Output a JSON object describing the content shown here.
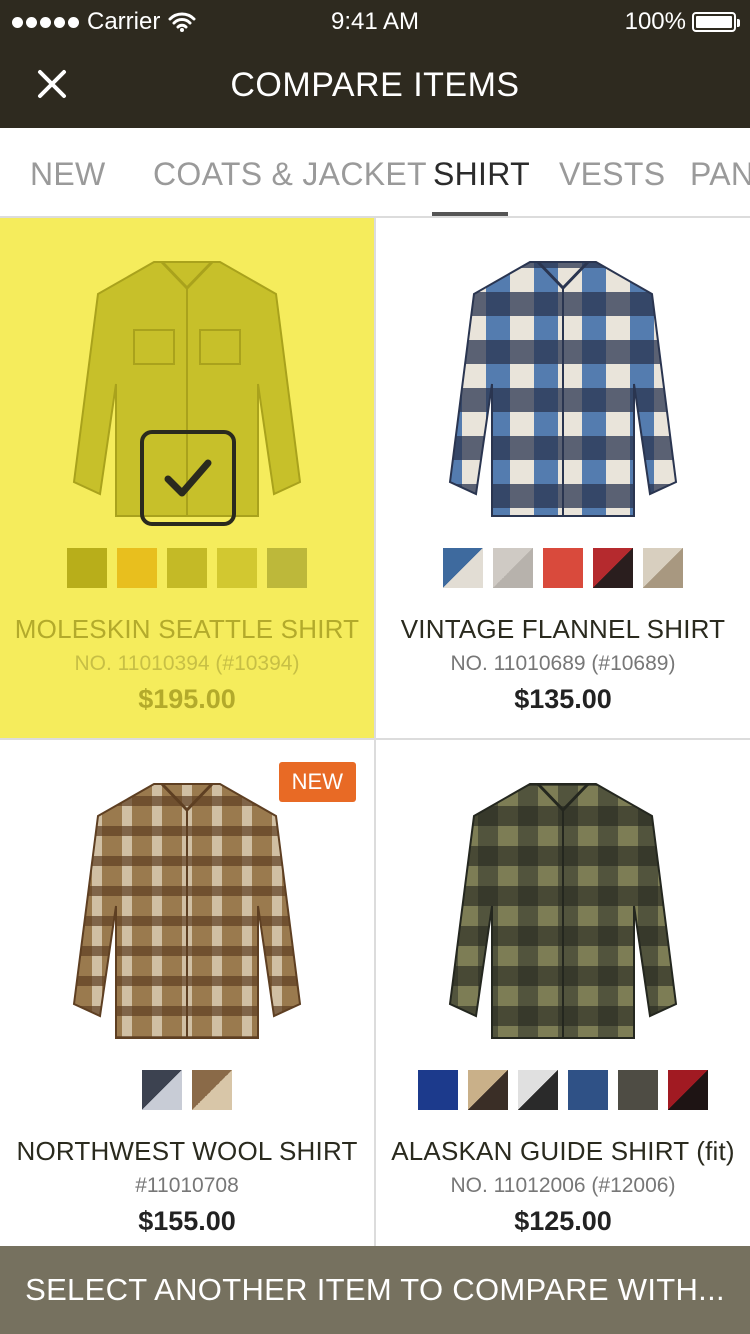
{
  "status_bar": {
    "carrier": "Carrier",
    "time": "9:41 AM",
    "battery": "100%"
  },
  "header": {
    "title": "COMPARE ITEMS",
    "close_icon": "close-icon"
  },
  "tabs": [
    {
      "label": "NEW",
      "active": false
    },
    {
      "label": "COATS & JACKET",
      "active": false
    },
    {
      "label": "SHIRT",
      "active": true
    },
    {
      "label": "VESTS",
      "active": false
    },
    {
      "label": "PAN",
      "active": false
    }
  ],
  "products": [
    {
      "name": "MOLESKIN SEATTLE SHIRT",
      "number": "NO. 11010394 (#10394)",
      "price": "$195.00",
      "selected": true,
      "badge": "",
      "image": "moleskin-shirt-icon",
      "swatches": [
        "#b8ae1a",
        "#e8bf1e",
        "#c4ba26",
        "#d2c830",
        "#bdb83a"
      ]
    },
    {
      "name": "VINTAGE FLANNEL SHIRT",
      "number": "NO. 11010689 (#10689)",
      "price": "$135.00",
      "selected": false,
      "badge": "",
      "image": "flannel-shirt-icon",
      "swatches": [
        "#3e6a9e",
        "#cfcac4",
        "#d94a3c",
        "#b52a2e",
        "#d8cfbf"
      ]
    },
    {
      "name": "NORTHWEST WOOL SHIRT",
      "number": "#11010708",
      "price": "$155.00",
      "selected": false,
      "badge": "NEW",
      "image": "wool-shirt-icon",
      "swatches": [
        "#3c4250",
        "#8a6a48"
      ]
    },
    {
      "name": "ALASKAN GUIDE SHIRT (fit)",
      "number": "NO. 11012006 (#12006)",
      "price": "$125.00",
      "selected": false,
      "badge": "",
      "image": "guide-shirt-icon",
      "swatches": [
        "#1c3a8c",
        "#c9b089",
        "#6e6e6e",
        "#2f5186",
        "#4e4c44",
        "#a11a22"
      ]
    }
  ],
  "footer": {
    "label": "SELECT ANOTHER ITEM TO COMPARE WITH..."
  }
}
